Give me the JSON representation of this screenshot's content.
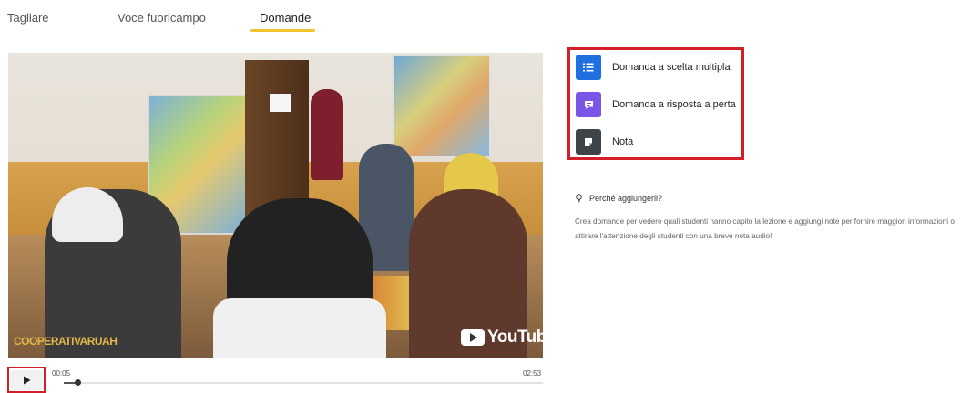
{
  "tabs": [
    {
      "label": "Tagliare",
      "active": false
    },
    {
      "label": "Voce fuoricampo",
      "active": false
    },
    {
      "label": "Domande",
      "active": true
    }
  ],
  "accent_color": "#f4c430",
  "highlight_color": "#d21f2a",
  "video": {
    "channel_watermark": "COOPERATIVARUAH",
    "provider_logo": "YouTube",
    "current_time": "00:05",
    "duration": "02:53",
    "progress_fraction": 0.029,
    "play_icon": "play-icon"
  },
  "question_types": [
    {
      "label": "Domanda a scelta multipla",
      "icon": "list-icon",
      "color": "#1f6fe0"
    },
    {
      "label": "Domanda a risposta a perta",
      "icon": "chat-icon",
      "color": "#7a55e6"
    },
    {
      "label": "Nota",
      "icon": "note-icon",
      "color": "#3f4448"
    }
  ],
  "info": {
    "icon": "lightbulb-icon",
    "title": "Perché aggiungerli?",
    "text": "Crea domande per vedere quali studenti hanno capito la lezione e aggiungi note per fornire maggiori informazioni o attirare l'attenzione degli studenti con una breve nota audio!"
  }
}
